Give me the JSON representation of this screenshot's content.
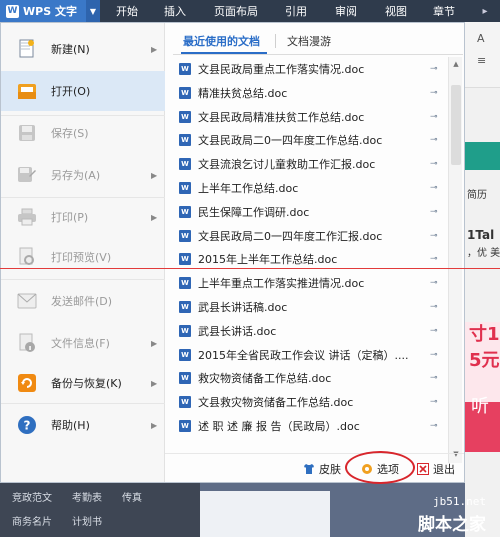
{
  "app": {
    "name": "WPS 文字",
    "logo_char": "W"
  },
  "ribbon": {
    "tabs": [
      "开始",
      "插入",
      "页面布局",
      "引用",
      "审阅",
      "视图",
      "章节"
    ]
  },
  "menu": {
    "items": [
      {
        "label": "新建(N)"
      },
      {
        "label": "打开(O)"
      },
      {
        "label": "保存(S)"
      },
      {
        "label": "另存为(A)"
      },
      {
        "label": "打印(P)"
      },
      {
        "label": "打印预览(V)"
      },
      {
        "label": "发送邮件(D)"
      },
      {
        "label": "文件信息(F)"
      },
      {
        "label": "备份与恢复(K)"
      },
      {
        "label": "帮助(H)"
      }
    ]
  },
  "content_tabs": {
    "recent": "最近使用的文档",
    "roam": "文档漫游"
  },
  "recent_files": [
    "文县民政局重点工作落实情况.doc",
    "精准扶贫总结.doc",
    "文县民政局精准扶贫工作总结.doc",
    "文县民政局二0一四年度工作总结.doc",
    "文县流浪乞讨儿童救助工作汇报.doc",
    "上半年工作总结.doc",
    "民生保障工作调研.doc",
    "文县民政局二0一四年度工作汇报.doc",
    "2015年上半年工作总结.doc",
    "上半年重点工作落实推进情况.doc",
    "武县长讲话稿.doc",
    "武县长讲话.doc",
    "2015年全省民政工作会议 讲话（定稿）....",
    "救灾物资储备工作总结.doc",
    "文县救灾物资储备工作总结.doc",
    "述 职 述 廉 报 告（民政局）.doc"
  ],
  "footer": {
    "skin": "皮肤",
    "options": "选项",
    "exit": "退出"
  },
  "background": {
    "bottom_items": [
      "竞政范文",
      "考勤表",
      "传真",
      "商务名片",
      "计划书"
    ],
    "right_texts": [
      "简历",
      "1Tal",
      "，优 美",
      "寸1",
      "5元",
      "听"
    ]
  },
  "watermark": {
    "url": "jb51.net",
    "brand": "脚本之家"
  },
  "colors": {
    "accent": "#2a6dc7",
    "active_item": "#dbe8f6",
    "annotation": "#d8262c",
    "ribbon_bg": "#2f3b4c"
  }
}
